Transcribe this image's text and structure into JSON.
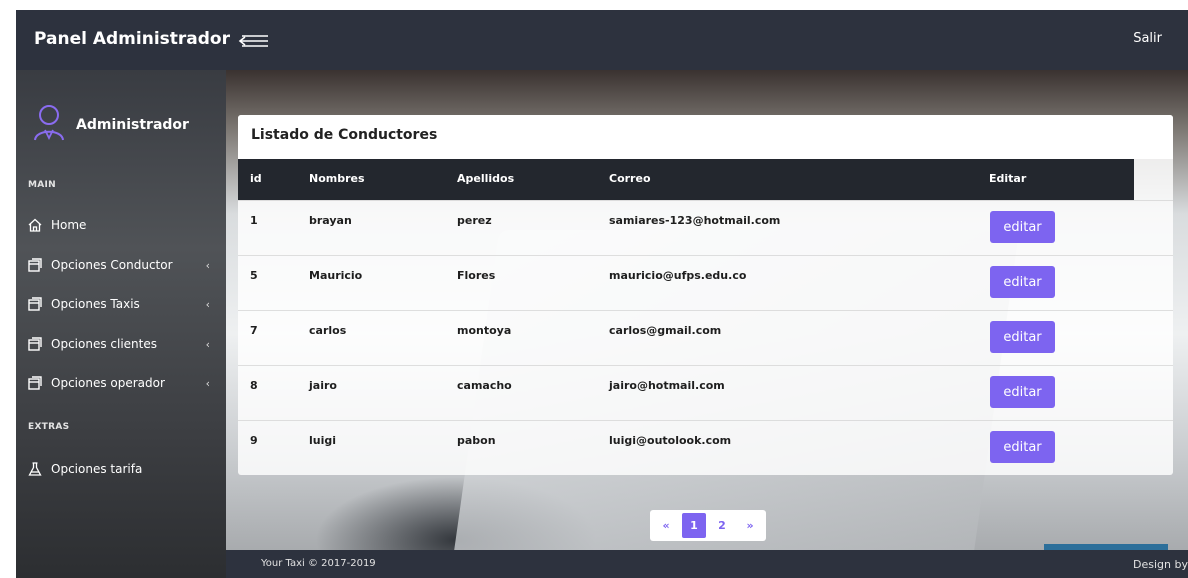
{
  "header": {
    "brand": "Panel Administrador",
    "logout": "Salir"
  },
  "sidebar": {
    "admin_name": "Administrador",
    "main_section": "MAIN",
    "extras_section": "EXTRAS",
    "items": [
      {
        "label": "Home",
        "icon": "home-icon",
        "has_chevron": false
      },
      {
        "label": "Opciones Conductor",
        "icon": "window-icon",
        "has_chevron": true
      },
      {
        "label": "Opciones Taxis",
        "icon": "window-icon",
        "has_chevron": true
      },
      {
        "label": "Opciones clientes",
        "icon": "window-icon",
        "has_chevron": true
      },
      {
        "label": "Opciones operador",
        "icon": "window-icon",
        "has_chevron": true
      },
      {
        "label": "Opciones tarifa",
        "icon": "flask-icon",
        "has_chevron": false
      }
    ],
    "chevron": "‹"
  },
  "table": {
    "title": "Listado de Conductores",
    "columns": [
      "id",
      "Nombres",
      "Apellidos",
      "Correo",
      "Editar"
    ],
    "rows": [
      {
        "id": "1",
        "nombres": "brayan",
        "apellidos": "perez",
        "correo": "samiares-123@hotmail.com",
        "action": "editar"
      },
      {
        "id": "5",
        "nombres": "Mauricio",
        "apellidos": "Flores",
        "correo": "mauricio@ufps.edu.co",
        "action": "editar"
      },
      {
        "id": "7",
        "nombres": "carlos",
        "apellidos": "montoya",
        "correo": "carlos@gmail.com",
        "action": "editar"
      },
      {
        "id": "8",
        "nombres": "jairo",
        "apellidos": "camacho",
        "correo": "jairo@hotmail.com",
        "action": "editar"
      },
      {
        "id": "9",
        "nombres": "luigi",
        "apellidos": "pabon",
        "correo": "luigi@outolook.com",
        "action": "editar"
      }
    ]
  },
  "pagination": {
    "prev": "«",
    "pages": [
      "1",
      "2"
    ],
    "active": "1",
    "next": "»"
  },
  "footer": {
    "copyright": "Your Taxi © 2017-2019",
    "design_by": "Design by"
  },
  "colors": {
    "accent": "#7d64f0",
    "topbar": "#2d323e",
    "table_header": "#23272e"
  }
}
